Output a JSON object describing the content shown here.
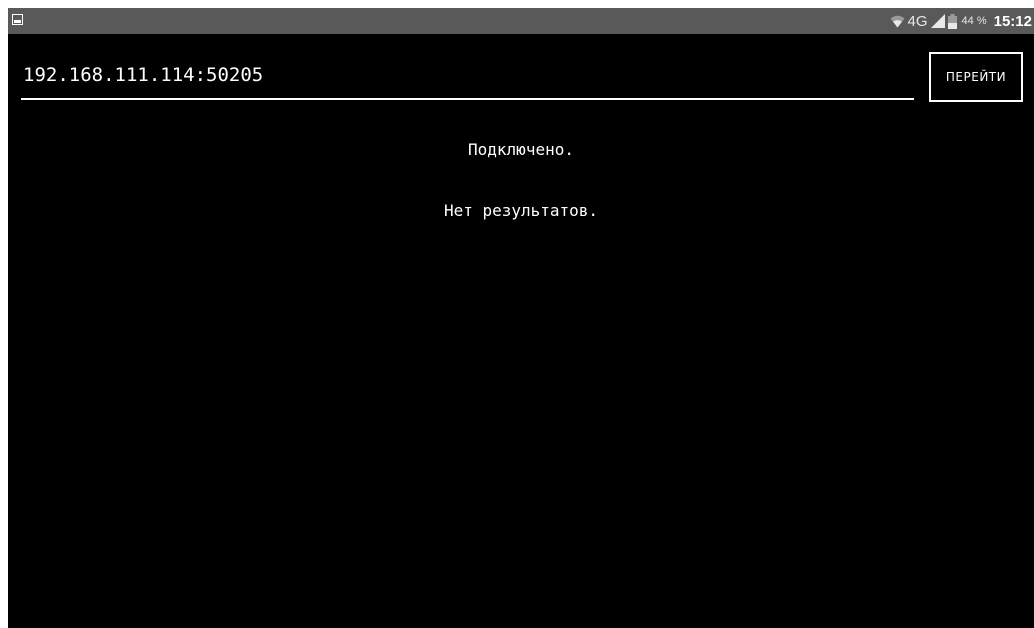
{
  "status_bar": {
    "network_type": "4G",
    "battery_percent": "44 %",
    "time": "15:12",
    "icons": [
      "image-notification-icon",
      "wifi-icon",
      "cell-signal-icon",
      "battery-icon"
    ]
  },
  "address": {
    "value": "192.168.111.114:50205"
  },
  "go_button": {
    "label": "ПЕРЕЙТИ"
  },
  "messages": {
    "connection_status": "Подключено.",
    "results": "Нет результатов."
  },
  "colors": {
    "background": "#000000",
    "status_bar": "#595959",
    "foreground": "#ffffff"
  }
}
